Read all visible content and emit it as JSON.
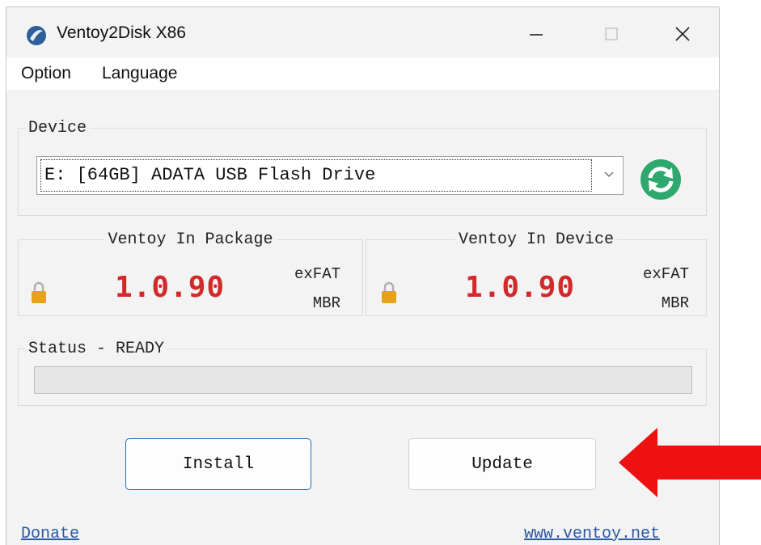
{
  "window": {
    "title": "Ventoy2Disk  X86",
    "app_icon": "ventoy-logo-icon",
    "controls": [
      "minimize-icon",
      "maximize-icon",
      "close-icon"
    ]
  },
  "menu": [
    {
      "label": "Option"
    },
    {
      "label": "Language"
    }
  ],
  "device": {
    "group_label": "Device",
    "selected": "E: [64GB] ADATA USB Flash Drive",
    "refresh_icon": "refresh-icon"
  },
  "package": {
    "group_label": "Ventoy In Package",
    "version": "1.0.90",
    "fs": "exFAT",
    "partition": "MBR"
  },
  "installed": {
    "group_label": "Ventoy In Device",
    "version": "1.0.90",
    "fs": "exFAT",
    "partition": "MBR"
  },
  "status": {
    "group_label": "Status - READY",
    "progress": 0
  },
  "buttons": {
    "install": "Install",
    "update": "Update"
  },
  "links": {
    "donate": "Donate",
    "website": "www.ventoy.net"
  },
  "colors": {
    "version_red": "#d22a2a",
    "refresh_green": "#2ea86c",
    "lock_orange": "#e8a21a",
    "annotation_arrow": "#ee1111",
    "install_border": "#1f6fbf"
  }
}
